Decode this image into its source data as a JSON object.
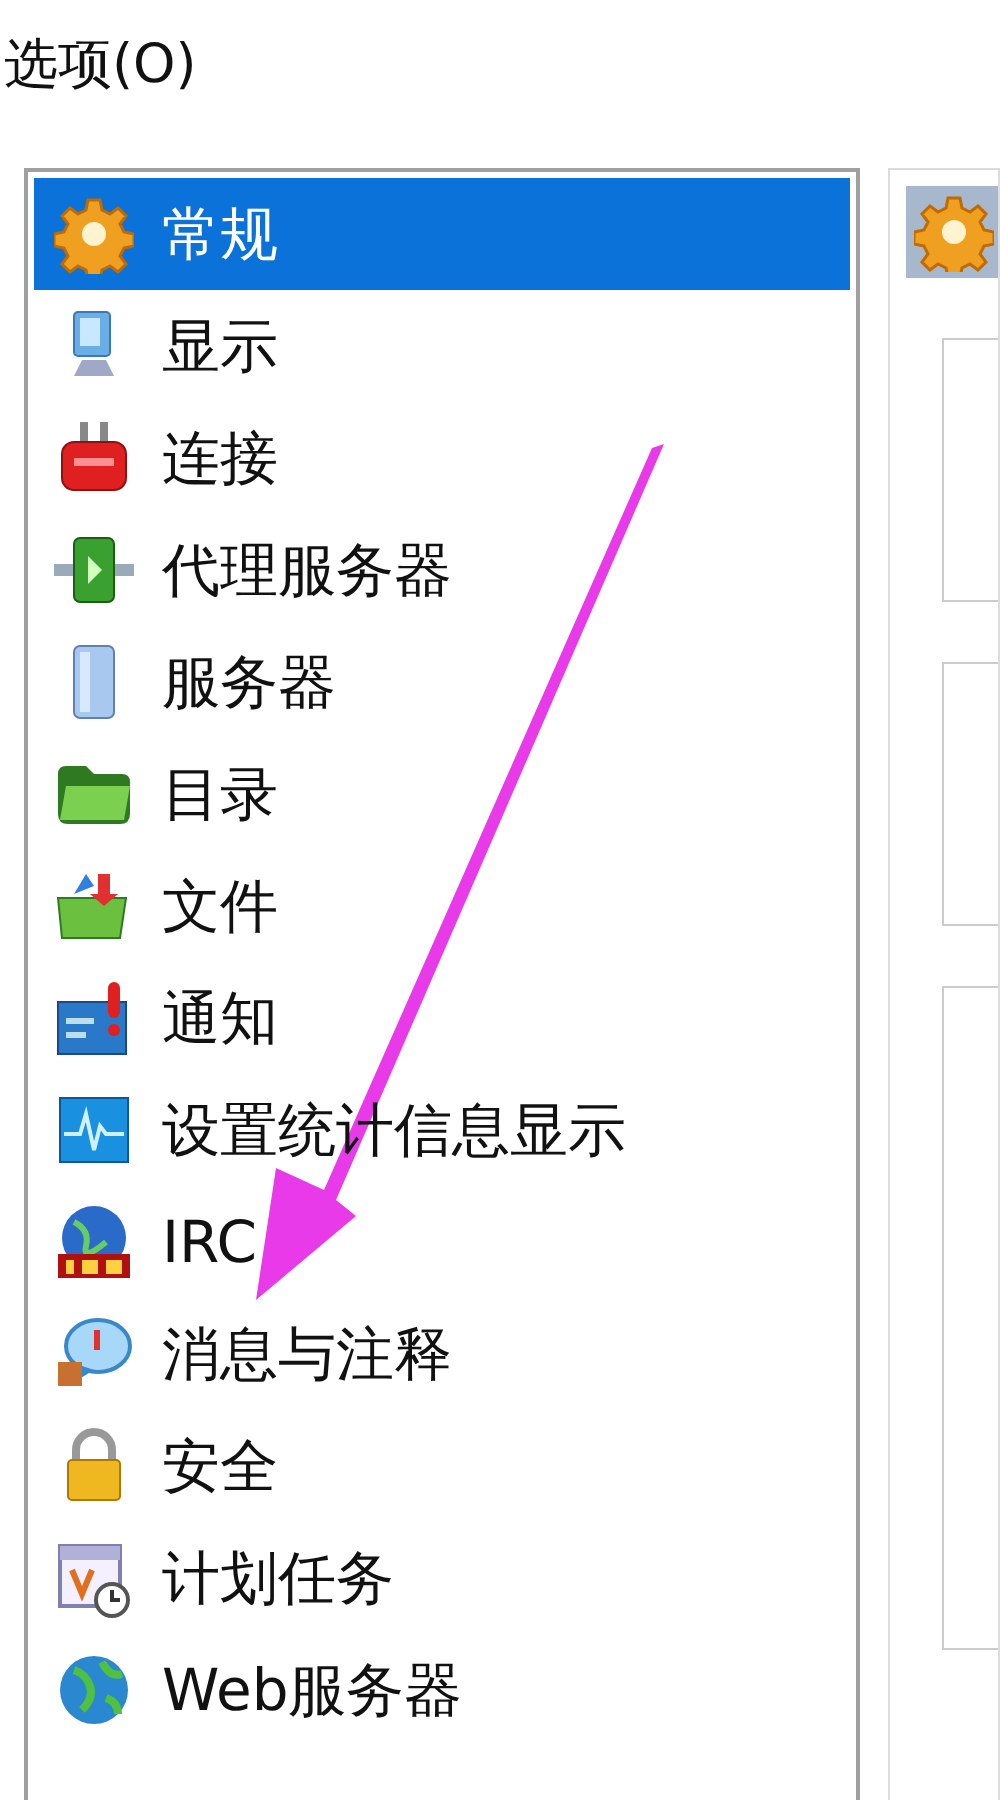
{
  "window": {
    "title": "选项(O)"
  },
  "sidebar": {
    "items": [
      {
        "label": "常规",
        "selected": true
      },
      {
        "label": "显示",
        "selected": false
      },
      {
        "label": "连接",
        "selected": false
      },
      {
        "label": "代理服务器",
        "selected": false
      },
      {
        "label": "服务器",
        "selected": false
      },
      {
        "label": "目录",
        "selected": false
      },
      {
        "label": "文件",
        "selected": false
      },
      {
        "label": "通知",
        "selected": false
      },
      {
        "label": "设置统计信息显示",
        "selected": false
      },
      {
        "label": "IRC",
        "selected": false
      },
      {
        "label": "消息与注释",
        "selected": false
      },
      {
        "label": "安全",
        "selected": false
      },
      {
        "label": "计划任务",
        "selected": false
      },
      {
        "label": "Web服务器",
        "selected": false
      }
    ]
  }
}
